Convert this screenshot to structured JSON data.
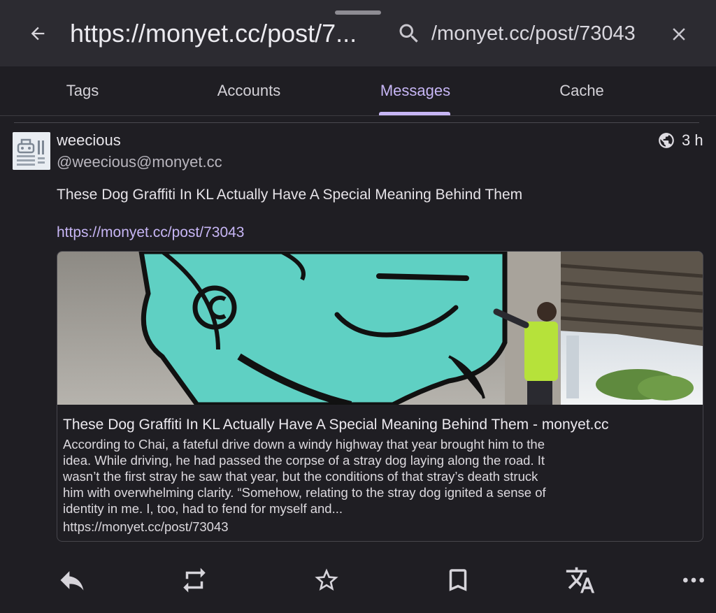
{
  "header": {
    "url_title": "https://monyet.cc/post/7...",
    "search_value": "/monyet.cc/post/73043",
    "search_placeholder": ""
  },
  "icons": {
    "back": "arrow-left-icon",
    "search": "search-icon",
    "close": "close-icon",
    "globe": "globe-icon",
    "reply": "reply-icon",
    "boost": "repeat-icon",
    "favourite": "star-icon",
    "bookmark": "bookmark-icon",
    "translate": "translate-icon",
    "more": "more-horizontal-icon"
  },
  "tabs": [
    {
      "label": "Tags",
      "active": false
    },
    {
      "label": "Accounts",
      "active": false
    },
    {
      "label": "Messages",
      "active": true
    },
    {
      "label": "Cache",
      "active": false
    }
  ],
  "post": {
    "display_name": "weecious",
    "handle": "@weecious@monyet.cc",
    "time": "3 h",
    "text": "These Dog Graffiti In KL Actually Have A Special Meaning Behind Them",
    "link": "https://monyet.cc/post/73043",
    "card": {
      "title": "These Dog Graffiti In KL Actually Have A Special Meaning Behind Them - monyet.cc",
      "description": "According to Chai, a fateful drive down a windy highway that year brought him to the idea. While driving, he had passed the corpse of a stray dog laying along the road. It wasn’t the first stray he saw that year, but the conditions of that stray’s death struck him with overwhelming clarity. “Somehow, relating to the stray dog ignited a sense of identity in me. I, too, had to fend for myself and...",
      "url": "https://monyet.cc/post/73043"
    }
  },
  "colors": {
    "accent": "#c7b6f5",
    "background": "#1f1e23",
    "toolbar": "#2c2b31",
    "mural": "#5fd0c3"
  }
}
